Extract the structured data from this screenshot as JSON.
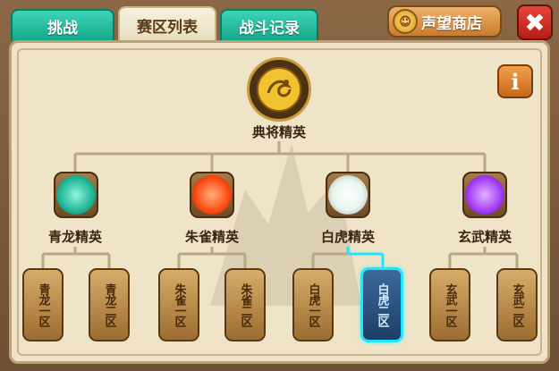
{
  "tabs": [
    {
      "label": "挑战"
    },
    {
      "label": "赛区列表"
    },
    {
      "label": "战斗记录"
    }
  ],
  "shop_button": {
    "label": "声望商店",
    "icon": "reputation-badge-icon"
  },
  "close_button": {
    "label": "✖"
  },
  "info_button": {
    "label": "i"
  },
  "top_node": {
    "label": "典将精英",
    "icon": "golden-dragon-emblem-icon"
  },
  "groups": [
    {
      "label": "青龙精英",
      "icon": "azure-dragon-icon",
      "color": "#2fd3b3",
      "zones": [
        {
          "label": "青龙一区"
        },
        {
          "label": "青龙二区"
        }
      ]
    },
    {
      "label": "朱雀精英",
      "icon": "vermilion-bird-icon",
      "color": "#ff5a1f",
      "zones": [
        {
          "label": "朱雀一区"
        },
        {
          "label": "朱雀二区"
        }
      ]
    },
    {
      "label": "白虎精英",
      "icon": "white-tiger-icon",
      "color": "#ffffff",
      "zones": [
        {
          "label": "白虎一区"
        },
        {
          "label": "白虎二区"
        }
      ]
    },
    {
      "label": "玄武精英",
      "icon": "black-tortoise-icon",
      "color": "#b04bff",
      "zones": [
        {
          "label": "玄武一区"
        },
        {
          "label": "玄武二区"
        }
      ]
    }
  ],
  "selected_zone": "白虎二区",
  "colors": {
    "tab_green": "#1fb596",
    "selected_border": "#1ee6ff",
    "line": "#b7a888"
  }
}
